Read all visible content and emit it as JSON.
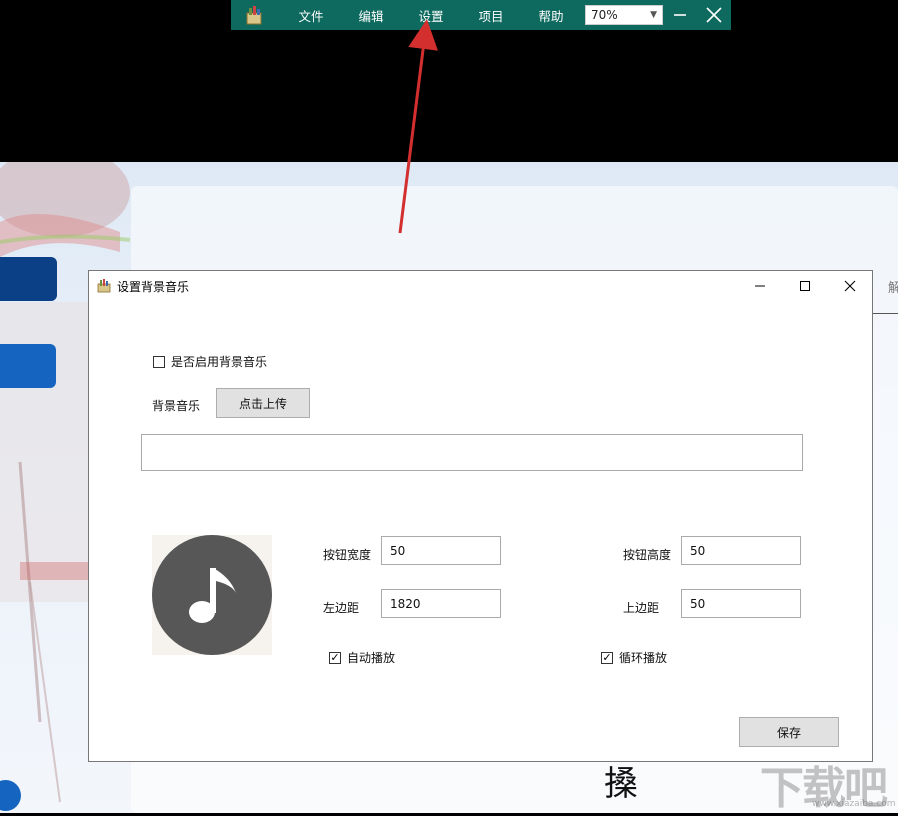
{
  "appbar": {
    "menu": [
      "文件",
      "编辑",
      "设置",
      "项目",
      "帮助"
    ],
    "zoom_value": "70%",
    "icons": [
      "app-logo-icon",
      "minimize-icon",
      "close-icon",
      "dropdown-caret-icon"
    ]
  },
  "background": {
    "big_char": "搡",
    "watermark": "下载吧",
    "watermark_url": "www.xiazaiba.com",
    "edge_char": "解"
  },
  "dialog": {
    "title": "设置背景音乐",
    "enable_music_label": "是否启用背景音乐",
    "enable_music_checked": false,
    "bg_music_label": "背景音乐",
    "upload_button": "点击上传",
    "file_path_value": "",
    "button_width_label": "按钮宽度",
    "button_width_value": "50",
    "button_height_label": "按钮高度",
    "button_height_value": "50",
    "left_margin_label": "左边距",
    "left_margin_value": "1820",
    "top_margin_label": "上边距",
    "top_margin_value": "50",
    "autoplay_label": "自动播放",
    "autoplay_checked": true,
    "loop_label": "循环播放",
    "loop_checked": true,
    "save_button": "保存",
    "thumbnail_icon": "music-note-icon",
    "window_icons": [
      "minimize-icon",
      "maximize-icon",
      "close-icon"
    ]
  },
  "colors": {
    "appbar_bg": "#0e6a5e",
    "annotation_arrow": "#d32f2f",
    "sidebar_dark_blue": "#0b3f86",
    "sidebar_blue": "#1565c0",
    "music_circle": "#575757"
  }
}
